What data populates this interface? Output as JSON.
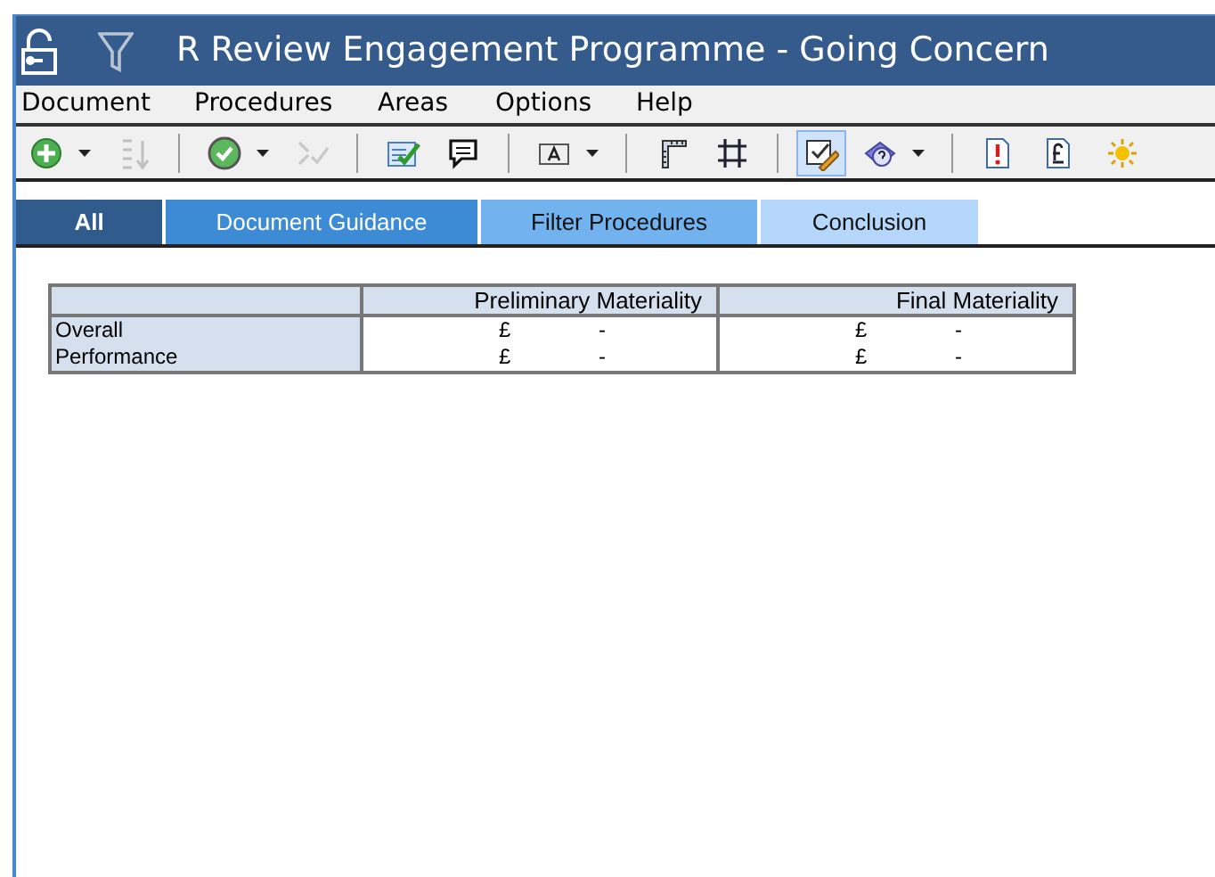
{
  "window": {
    "title": "R Review Engagement Programme - Going Concern"
  },
  "menu": [
    "Document",
    "Procedures",
    "Areas",
    "Options",
    "Help"
  ],
  "toolbar": [
    {
      "kind": "add",
      "dropdown": true,
      "disabled": false,
      "selected": false
    },
    {
      "kind": "sort",
      "dropdown": false,
      "disabled": true,
      "selected": false
    },
    {
      "kind": "separator"
    },
    {
      "kind": "check",
      "dropdown": true,
      "disabled": false,
      "selected": false
    },
    {
      "kind": "merge",
      "dropdown": false,
      "disabled": true,
      "selected": false
    },
    {
      "kind": "separator"
    },
    {
      "kind": "checklist",
      "dropdown": false,
      "disabled": false,
      "selected": false
    },
    {
      "kind": "comment",
      "dropdown": false,
      "disabled": false,
      "selected": false
    },
    {
      "kind": "separator"
    },
    {
      "kind": "textbox",
      "dropdown": true,
      "disabled": false,
      "selected": false
    },
    {
      "kind": "separator"
    },
    {
      "kind": "ruler",
      "dropdown": false,
      "disabled": false,
      "selected": false
    },
    {
      "kind": "grid",
      "dropdown": false,
      "disabled": false,
      "selected": false
    },
    {
      "kind": "separator"
    },
    {
      "kind": "edit",
      "dropdown": false,
      "disabled": false,
      "selected": true
    },
    {
      "kind": "help",
      "dropdown": true,
      "disabled": false,
      "selected": false
    },
    {
      "kind": "separator"
    },
    {
      "kind": "alert",
      "dropdown": false,
      "disabled": false,
      "selected": false
    },
    {
      "kind": "pound",
      "dropdown": false,
      "disabled": false,
      "selected": false
    },
    {
      "kind": "sun",
      "dropdown": false,
      "disabled": false,
      "selected": false
    }
  ],
  "tabs": [
    {
      "label": "All",
      "selected": true,
      "color": "#2f5c8c"
    },
    {
      "label": "Document Guidance",
      "selected": false,
      "color": "#3d8bd4"
    },
    {
      "label": "Filter Procedures",
      "selected": false,
      "color": "#72b2ee"
    },
    {
      "label": "Conclusion",
      "selected": false,
      "color": "#b5d7fb"
    }
  ],
  "table": {
    "columns": [
      "Preliminary Materiality",
      "Final Materiality"
    ],
    "rows": [
      {
        "label": "Overall",
        "cells": [
          {
            "currency": "£",
            "value": "-"
          },
          {
            "currency": "£",
            "value": "-"
          }
        ]
      },
      {
        "label": "Performance",
        "cells": [
          {
            "currency": "£",
            "value": "-"
          },
          {
            "currency": "£",
            "value": "-"
          }
        ]
      }
    ]
  }
}
